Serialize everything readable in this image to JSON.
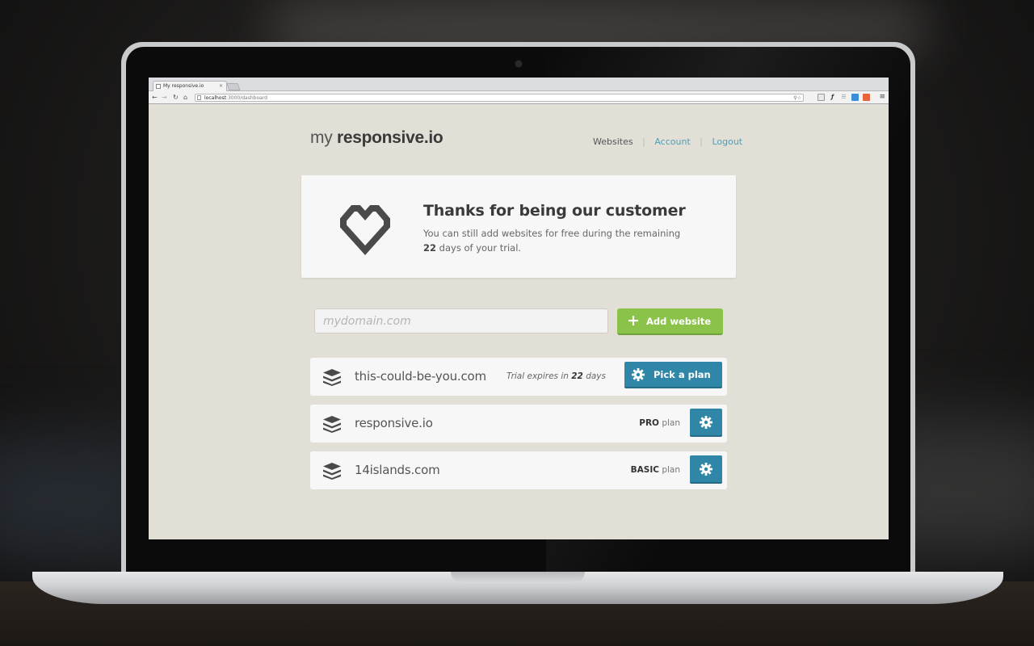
{
  "browser": {
    "tab_title": "My responsive.io",
    "tab_close": "×",
    "url_host": "localhost",
    "url_path": ":3000/dashboard"
  },
  "header": {
    "logo_light": "my",
    "logo_bold": "responsive.io",
    "nav": [
      {
        "label": "Websites"
      },
      {
        "label": "Account"
      },
      {
        "label": "Logout"
      }
    ],
    "separator": "|"
  },
  "banner": {
    "title": "Thanks for being our customer",
    "text_before": "You can still add websites for free during the remaining ",
    "days": "22",
    "text_after": " days of your trial."
  },
  "add_form": {
    "placeholder": "mydomain.com",
    "value": "",
    "button_label": "Add website",
    "button_icon": "+"
  },
  "sites": [
    {
      "domain": "this-could-be-you.com",
      "trial_prefix": "Trial expires in ",
      "trial_days": "22",
      "trial_suffix": " days",
      "action_label": "Pick a plan"
    },
    {
      "domain": "responsive.io",
      "plan_name": "PRO",
      "plan_suffix": " plan"
    },
    {
      "domain": "14islands.com",
      "plan_name": "BASIC",
      "plan_suffix": " plan"
    }
  ],
  "colors": {
    "page_bg": "#e1dfd6",
    "card_bg": "#f7f7f7",
    "accent_blue": "#2f86a7",
    "accent_green": "#8bc34a",
    "link": "#4f9fbb"
  }
}
